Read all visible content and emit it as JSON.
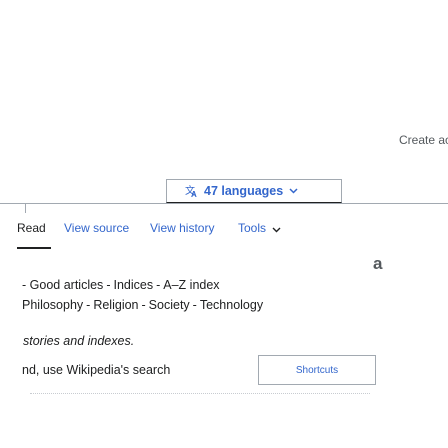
{
  "header": {
    "create_account_label": "Create ac"
  },
  "languages": {
    "label": "47 languages",
    "icon": "translate-icon"
  },
  "tabs": {
    "read": "Read",
    "view_source": "View source",
    "view_history": "View history",
    "tools": "Tools"
  },
  "content": {
    "portals_line1": {
      "prefix": "-",
      "items": [
        "Good articles",
        "Indices",
        "A–Z index"
      ]
    },
    "portals_line2": {
      "items": [
        "Philosophy",
        "Religion",
        "Society",
        "Technology"
      ]
    },
    "stories_text": "stories and indexes.",
    "search_hint": "nd, use Wikipedia's search",
    "shortcuts_label": "Shortcuts"
  },
  "colors": {
    "link": "#3366cc",
    "text": "#202122",
    "border": "#a2a9b1"
  }
}
